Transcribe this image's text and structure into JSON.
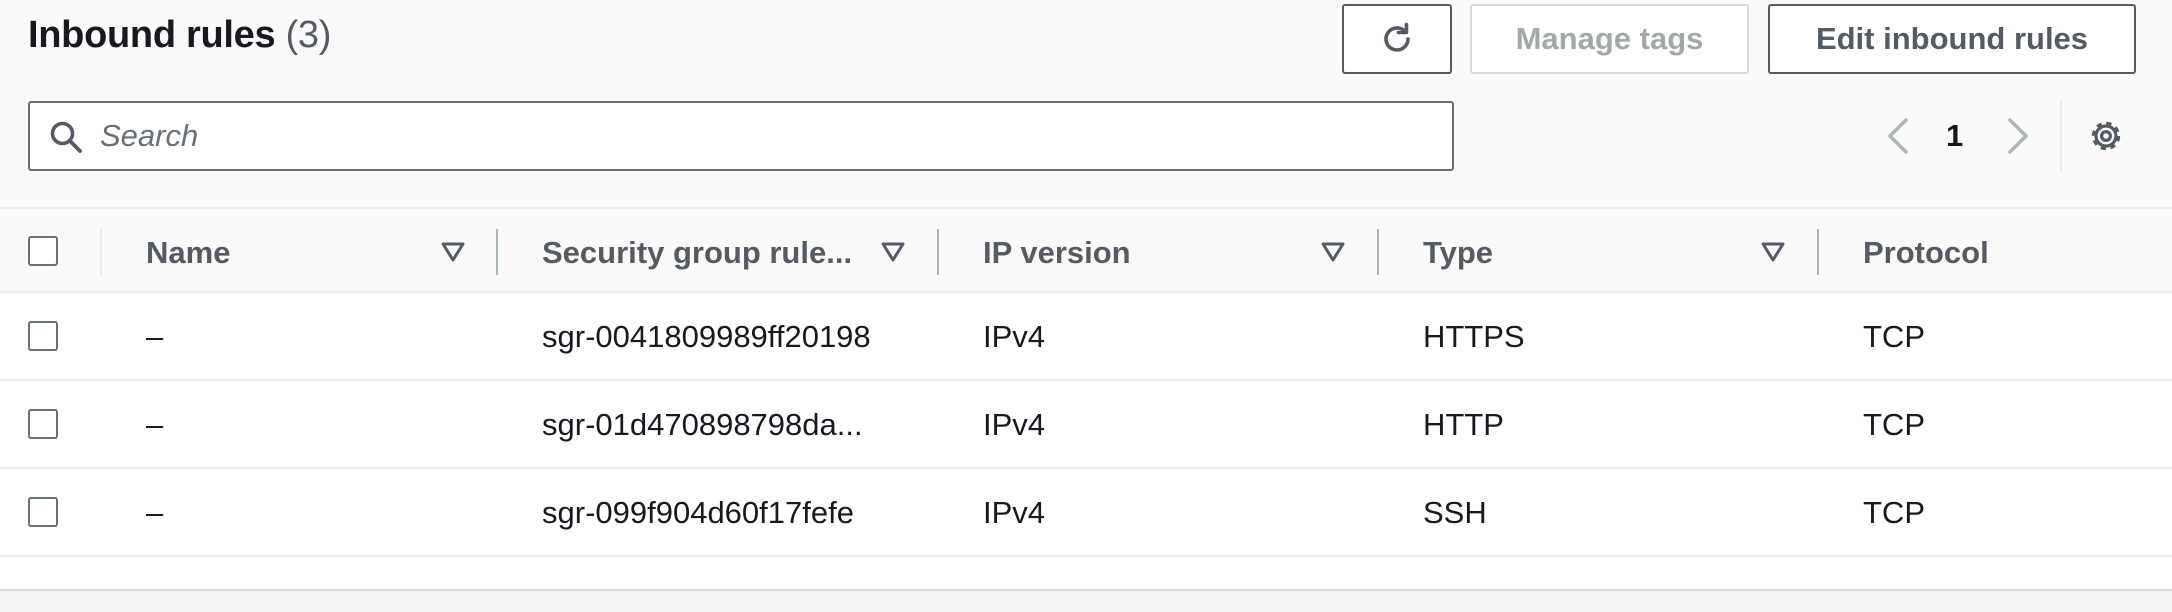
{
  "header": {
    "title": "Inbound rules",
    "count": "(3)"
  },
  "toolbar": {
    "refresh_icon": "refresh-icon",
    "manage_tags_label": "Manage tags",
    "edit_label": "Edit inbound rules"
  },
  "search": {
    "placeholder": "Search",
    "value": ""
  },
  "pagination": {
    "current_page": "1"
  },
  "table": {
    "columns": [
      {
        "label": "Name"
      },
      {
        "label": "Security group rule..."
      },
      {
        "label": "IP version"
      },
      {
        "label": "Type"
      },
      {
        "label": "Protocol"
      }
    ],
    "rows": [
      {
        "name": "–",
        "rule_id": "sgr-0041809989ff20198",
        "ip_version": "IPv4",
        "type": "HTTPS",
        "protocol": "TCP"
      },
      {
        "name": "–",
        "rule_id": "sgr-01d470898798da...",
        "ip_version": "IPv4",
        "type": "HTTP",
        "protocol": "TCP"
      },
      {
        "name": "–",
        "rule_id": "sgr-099f904d60f17fefe",
        "ip_version": "IPv4",
        "type": "SSH",
        "protocol": "TCP"
      }
    ]
  },
  "colors": {
    "text": "#16191f",
    "secondary_text": "#545b64",
    "disabled_text": "#a3a9aa",
    "border": "#eaeded"
  }
}
